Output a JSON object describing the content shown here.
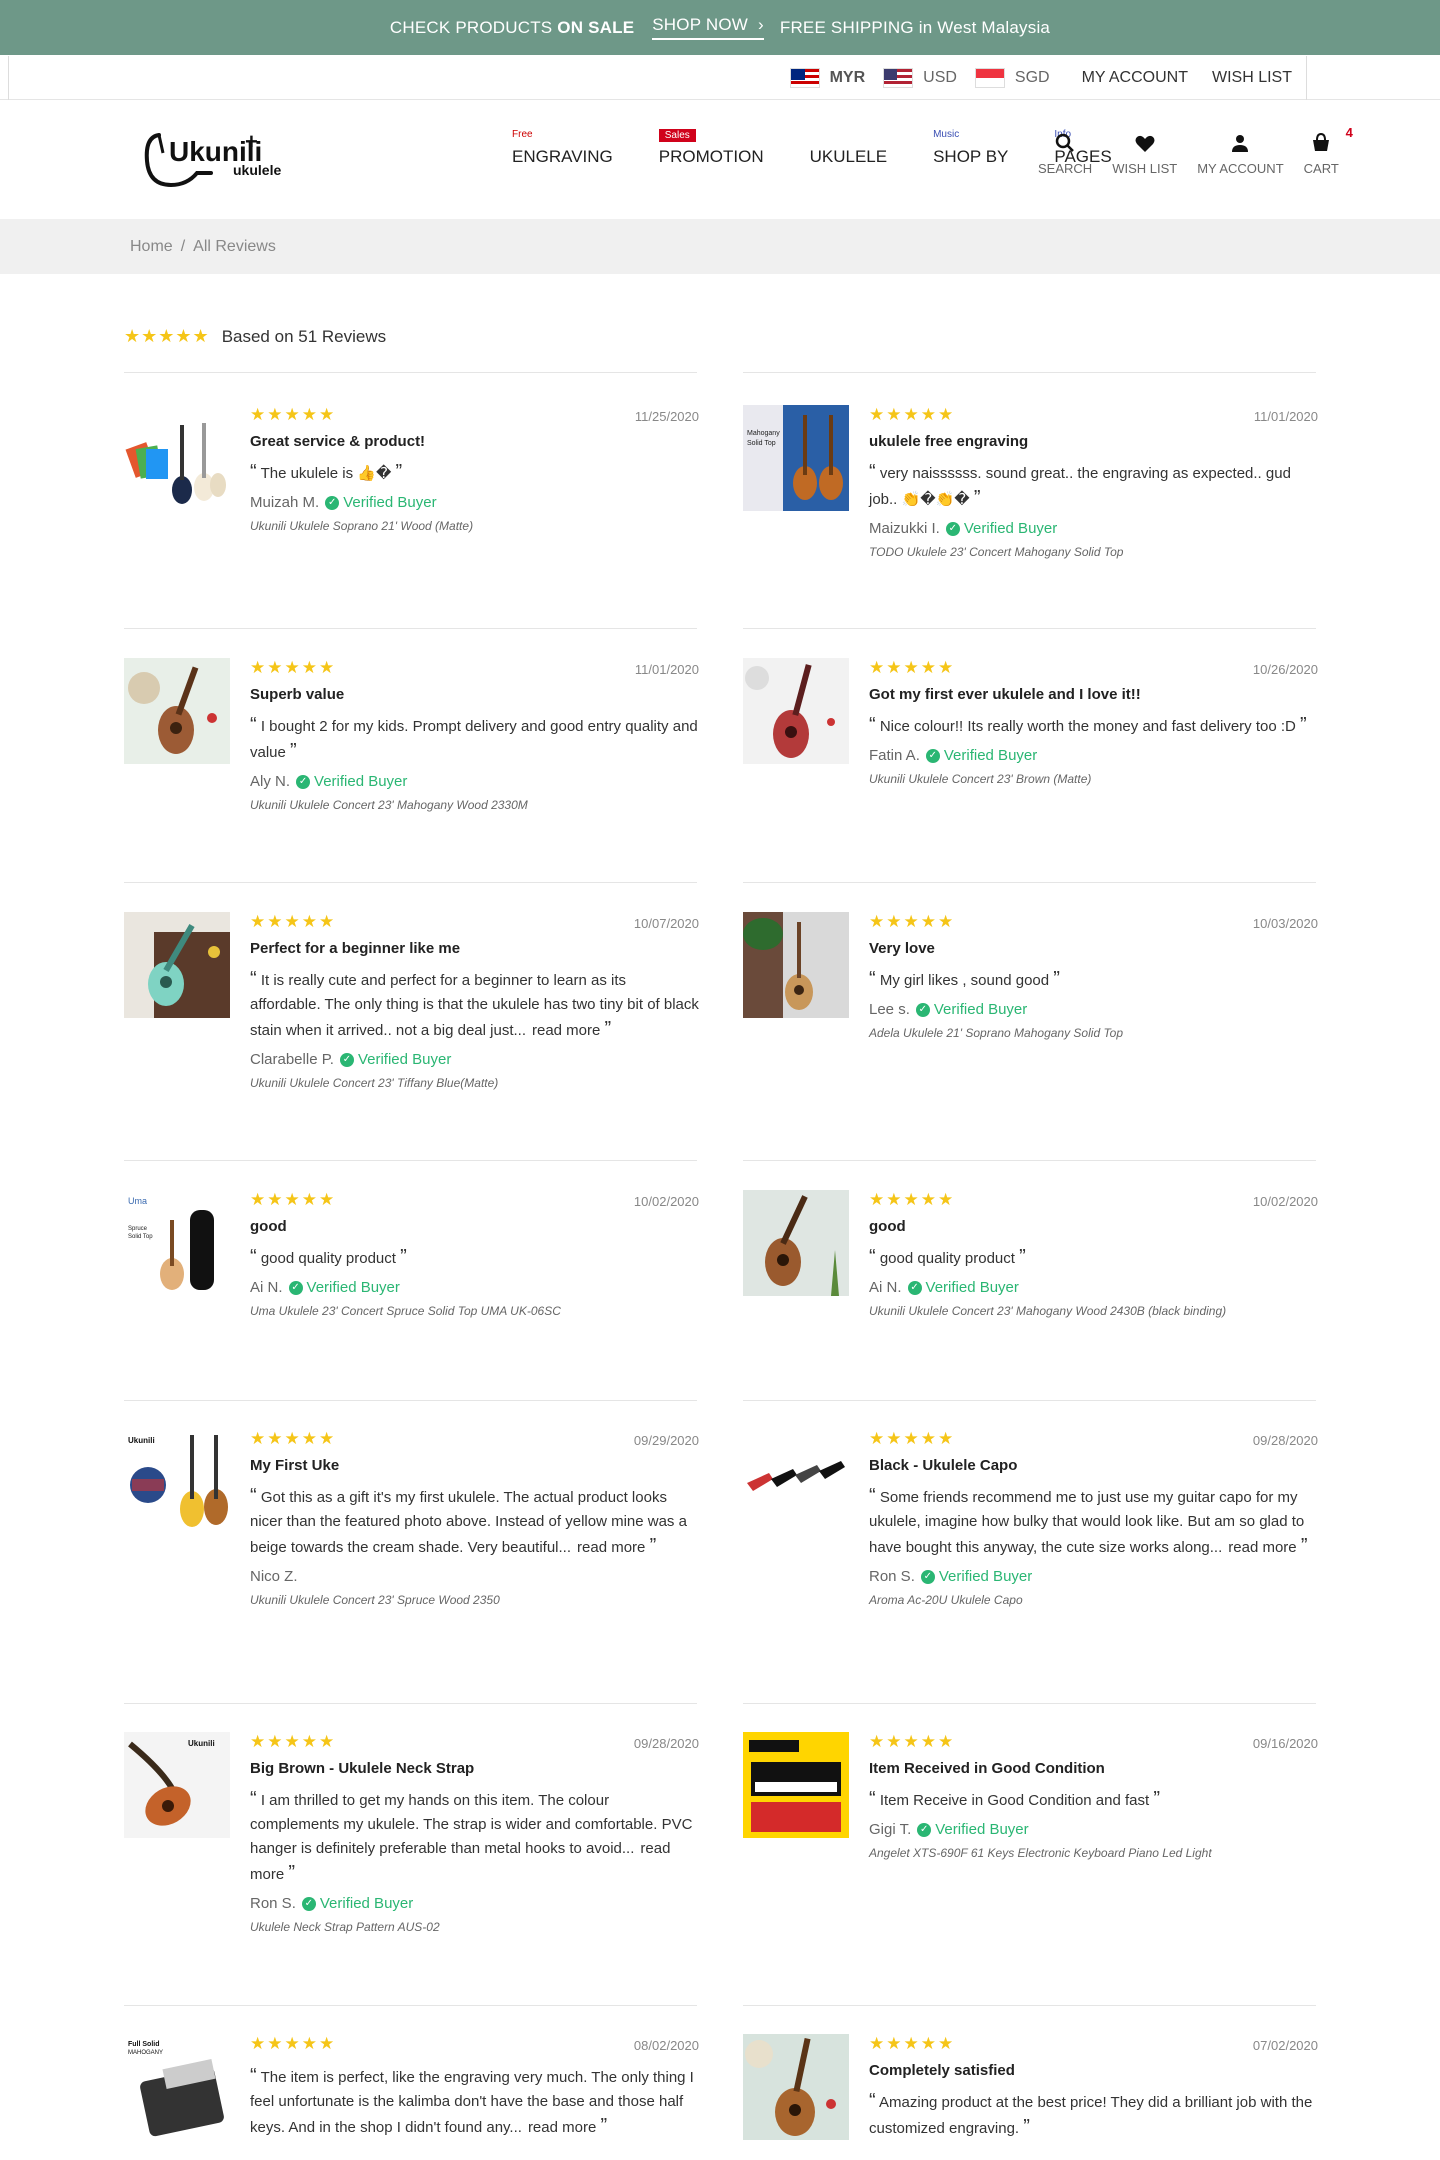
{
  "announcement": {
    "check_products": "CHECK PRODUCTS",
    "on_sale": "ON SALE",
    "shop_now": "SHOP NOW",
    "free_shipping": "FREE SHIPPING",
    "in_region": "in West Malaysia"
  },
  "utility": {
    "currencies": [
      "MYR",
      "USD",
      "SGD"
    ],
    "my_account": "MY ACCOUNT",
    "wish_list": "WISH LIST"
  },
  "logo": {
    "name": "Ukunili",
    "sub": "ukulele"
  },
  "nav": [
    {
      "label": "ENGRAVING",
      "tag": "Free"
    },
    {
      "label": "PROMOTION",
      "tag": "Sales"
    },
    {
      "label": "UKULELE",
      "tag": ""
    },
    {
      "label": "SHOP BY",
      "tag": "Music"
    },
    {
      "label": "PAGES",
      "tag": "Info"
    }
  ],
  "header_icons": {
    "search": "SEARCH",
    "wish_list": "WISH LIST",
    "my_account": "MY ACCOUNT",
    "cart": "CART",
    "cart_count": "4"
  },
  "breadcrumb": {
    "home": "Home",
    "sep": "/",
    "current": "All Reviews"
  },
  "summary": {
    "stars": "★★★★★",
    "text": "Based on 51 Reviews"
  },
  "colors": {
    "accent_bar": "#6e9888",
    "star": "#f5c518",
    "verified": "#2ab673",
    "sale_tag": "#d0021b"
  },
  "verified_label": "Verified Buyer",
  "read_more": "read more",
  "reviews": [
    {
      "date": "11/25/2020",
      "title": "Great service & product!",
      "text": "The ukulele is 👍�",
      "author": "Muizah M.",
      "verified": true,
      "product": "Ukunili Ukulele Soprano 21' Wood (Matte)",
      "read_more": false
    },
    {
      "date": "11/01/2020",
      "title": "ukulele free engraving",
      "text": "very naissssss. sound great.. the engraving as expected.. gud job.. 👏�👏�",
      "author": "Maizukki I.",
      "verified": true,
      "product": "TODO Ukulele 23' Concert Mahogany Solid Top",
      "read_more": false
    },
    {
      "date": "11/01/2020",
      "title": "Superb value",
      "text": "I bought 2 for my kids. Prompt delivery and good entry quality and value",
      "author": "Aly N.",
      "verified": true,
      "product": "Ukunili Ukulele Concert 23' Mahogany Wood 2330M",
      "read_more": false
    },
    {
      "date": "10/26/2020",
      "title": "Got my first ever ukulele and I love it!!",
      "text": "Nice colour!! Its really worth the money and fast delivery too :D",
      "author": "Fatin A.",
      "verified": true,
      "product": "Ukunili Ukulele Concert 23' Brown (Matte)",
      "read_more": false
    },
    {
      "date": "10/07/2020",
      "title": "Perfect for a beginner like me",
      "text": "It is really cute and perfect for a beginner to learn as its affordable. The only thing is that the ukulele has two tiny bit of black stain when it arrived.. not a big deal just...",
      "author": "Clarabelle P.",
      "verified": true,
      "product": "Ukunili Ukulele Concert 23' Tiffany Blue(Matte)",
      "read_more": true
    },
    {
      "date": "10/03/2020",
      "title": "Very love",
      "text": "My girl likes , sound good",
      "author": "Lee s.",
      "verified": true,
      "product": "Adela Ukulele 21' Soprano Mahogany Solid Top",
      "read_more": false
    },
    {
      "date": "10/02/2020",
      "title": "good",
      "text": "good quality product",
      "author": "Ai N.",
      "verified": true,
      "product": "Uma Ukulele 23' Concert Spruce Solid Top UMA UK-06SC",
      "read_more": false
    },
    {
      "date": "10/02/2020",
      "title": "good",
      "text": "good quality product",
      "author": "Ai N.",
      "verified": true,
      "product": "Ukunili Ukulele Concert 23' Mahogany Wood 2430B (black binding)",
      "read_more": false
    },
    {
      "date": "09/29/2020",
      "title": "My First Uke",
      "text": "Got this as a gift it's my first ukulele. The actual product looks nicer than the featured photo above. Instead of yellow mine was a beige towards the cream shade. Very beautiful...",
      "author": "Nico Z.",
      "verified": false,
      "product": "Ukunili Ukulele Concert 23' Spruce Wood 2350",
      "read_more": true
    },
    {
      "date": "09/28/2020",
      "title": "Black - Ukulele Capo",
      "text": "Some friends recommend me to just use my guitar capo for my ukulele, imagine how bulky that would look like. But am so glad to have bought this anyway, the cute size works along...",
      "author": "Ron S.",
      "verified": true,
      "product": "Aroma Ac-20U Ukulele Capo",
      "read_more": true
    },
    {
      "date": "09/28/2020",
      "title": "Big Brown - Ukulele Neck Strap",
      "text": "I am thrilled to get my hands on this item. The colour complements my ukulele. The strap is wider and comfortable. PVC hanger is definitely preferable than metal hooks to avoid...",
      "author": "Ron S.",
      "verified": true,
      "product": "Ukulele Neck Strap Pattern AUS-02",
      "read_more": true
    },
    {
      "date": "09/16/2020",
      "title": "Item Received in Good Condition",
      "text": "Item Receive in Good Condition and fast",
      "author": "Gigi T.",
      "verified": true,
      "product": "Angelet XTS-690F 61 Keys Electronic Keyboard Piano Led Light",
      "read_more": false
    },
    {
      "date": "08/02/2020",
      "title": "",
      "text": "The item is perfect, like the engraving very much. The only thing I feel unfortunate is the kalimba don't have the base and those half keys. And in the shop I didn't found any...",
      "author": "",
      "verified": false,
      "product": "",
      "read_more": true
    },
    {
      "date": "07/02/2020",
      "title": "Completely satisfied",
      "text": "Amazing product at the best price! They did a brilliant job with the customized engraving.",
      "author": "",
      "verified": false,
      "product": "",
      "read_more": false
    }
  ]
}
